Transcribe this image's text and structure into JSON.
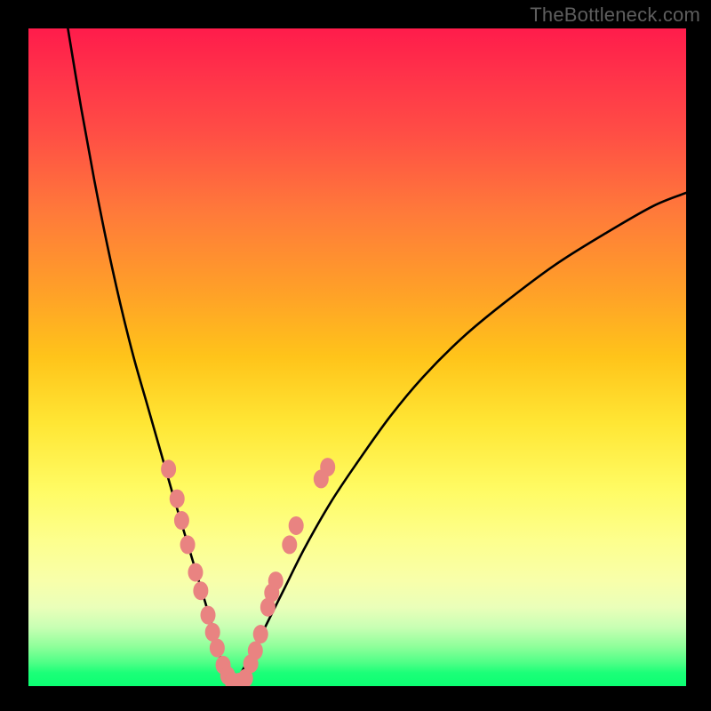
{
  "watermark": "TheBottleneck.com",
  "chart_data": {
    "type": "line",
    "title": "",
    "xlabel": "",
    "ylabel": "",
    "xlim": [
      0,
      100
    ],
    "ylim": [
      0,
      100
    ],
    "grid": false,
    "legend": false,
    "series": [
      {
        "name": "left-branch",
        "x": [
          6,
          8,
          10,
          12,
          14,
          16,
          18,
          20,
          22,
          23.5,
          25,
          26.5,
          28,
          29,
          30,
          31
        ],
        "y": [
          100,
          88,
          77,
          67,
          58,
          50,
          43,
          36,
          29,
          24,
          19,
          14,
          9,
          5,
          2,
          0.5
        ]
      },
      {
        "name": "right-branch",
        "x": [
          31,
          32,
          34,
          36,
          39,
          42,
          46,
          50,
          55,
          60,
          66,
          72,
          80,
          88,
          95,
          100
        ],
        "y": [
          0.5,
          1.5,
          5,
          9,
          15,
          21,
          28,
          34,
          41,
          47,
          53,
          58,
          64,
          69,
          73,
          75
        ]
      }
    ],
    "points": {
      "name": "highlighted-points",
      "color": "#e98381",
      "items": [
        {
          "x": 21.3,
          "y": 33.0
        },
        {
          "x": 22.6,
          "y": 28.5
        },
        {
          "x": 23.3,
          "y": 25.2
        },
        {
          "x": 24.2,
          "y": 21.5
        },
        {
          "x": 25.4,
          "y": 17.3
        },
        {
          "x": 26.2,
          "y": 14.5
        },
        {
          "x": 27.3,
          "y": 10.8
        },
        {
          "x": 28.0,
          "y": 8.2
        },
        {
          "x": 28.7,
          "y": 5.8
        },
        {
          "x": 29.6,
          "y": 3.2
        },
        {
          "x": 30.3,
          "y": 1.6
        },
        {
          "x": 31.0,
          "y": 0.7
        },
        {
          "x": 32.0,
          "y": 0.6
        },
        {
          "x": 33.0,
          "y": 1.2
        },
        {
          "x": 33.8,
          "y": 3.4
        },
        {
          "x": 34.5,
          "y": 5.4
        },
        {
          "x": 35.3,
          "y": 7.9
        },
        {
          "x": 36.4,
          "y": 12.0
        },
        {
          "x": 37.0,
          "y": 14.2
        },
        {
          "x": 37.6,
          "y": 16.0
        },
        {
          "x": 39.7,
          "y": 21.5
        },
        {
          "x": 40.7,
          "y": 24.4
        },
        {
          "x": 44.5,
          "y": 31.5
        },
        {
          "x": 45.5,
          "y": 33.3
        }
      ]
    }
  }
}
